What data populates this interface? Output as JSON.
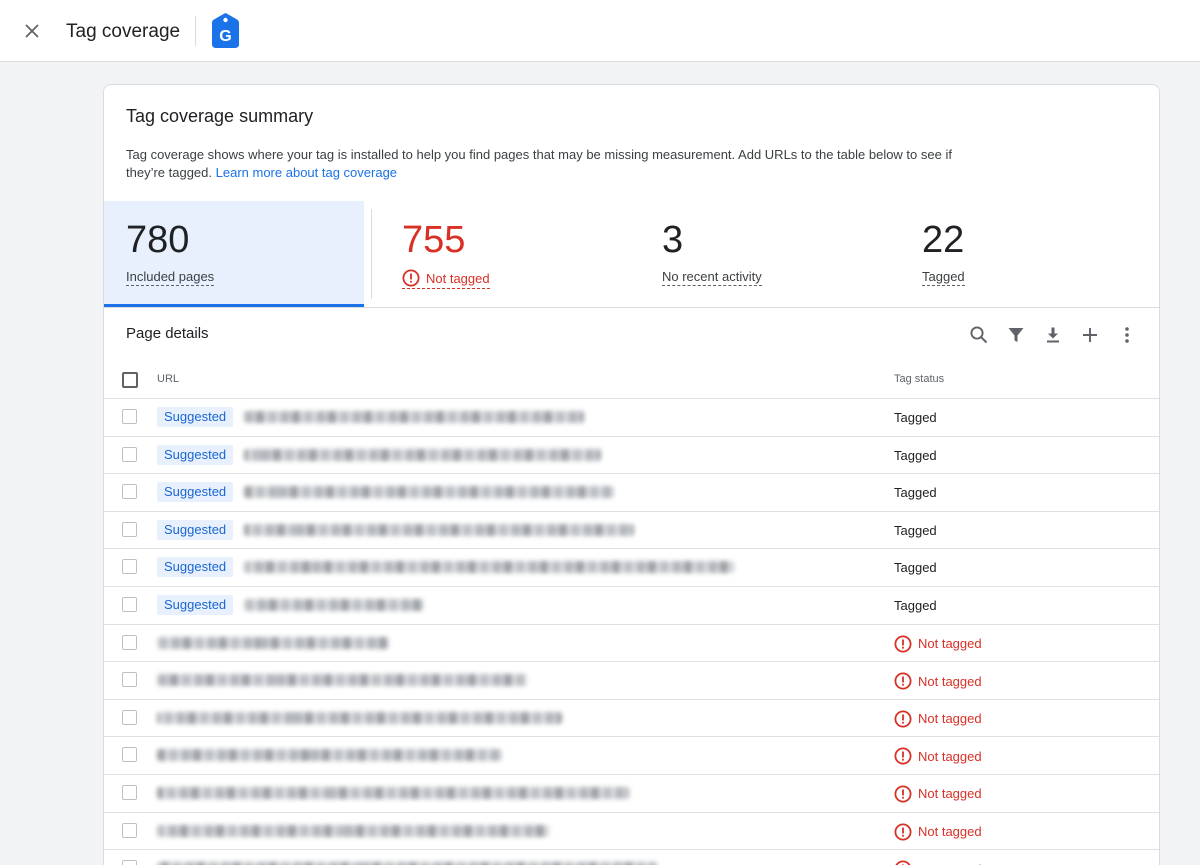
{
  "app": {
    "title": "Tag coverage",
    "logo_letter": "G",
    "colors": {
      "accent": "#1a73e8",
      "danger": "#d93025",
      "selected_bg": "#e8f0fe"
    }
  },
  "summary": {
    "title": "Tag coverage summary",
    "description": "Tag coverage shows where your tag is installed to help you find pages that may be missing measurement. Add URLs to the table below to see if they’re tagged.",
    "learn_more": "Learn more about tag coverage",
    "metrics": [
      {
        "value": "780",
        "label": "Included pages",
        "selected": true
      },
      {
        "value": "755",
        "label": "Not tagged",
        "icon": "error-icon"
      },
      {
        "value": "3",
        "label": "No recent activity"
      },
      {
        "value": "22",
        "label": "Tagged"
      }
    ]
  },
  "details": {
    "title": "Page details",
    "toolbar": [
      "search-icon",
      "filter-icon",
      "download-icon",
      "add-icon",
      "more-vert-icon"
    ],
    "columns": {
      "url": "URL",
      "status": "Tag status"
    },
    "suggested_label": "Suggested",
    "rows": [
      {
        "suggested": true,
        "url_blurred": true,
        "status": "Tagged"
      },
      {
        "suggested": true,
        "url_blurred": true,
        "status": "Tagged"
      },
      {
        "suggested": true,
        "url_blurred": true,
        "status": "Tagged"
      },
      {
        "suggested": true,
        "url_blurred": true,
        "status": "Tagged"
      },
      {
        "suggested": true,
        "url_blurred": true,
        "status": "Tagged"
      },
      {
        "suggested": true,
        "url_blurred": true,
        "status": "Tagged"
      },
      {
        "suggested": false,
        "url_blurred": true,
        "status": "Not tagged"
      },
      {
        "suggested": false,
        "url_blurred": true,
        "status": "Not tagged"
      },
      {
        "suggested": false,
        "url_blurred": true,
        "status": "Not tagged"
      },
      {
        "suggested": false,
        "url_blurred": true,
        "status": "Not tagged"
      },
      {
        "suggested": false,
        "url_blurred": true,
        "status": "Not tagged"
      },
      {
        "suggested": false,
        "url_blurred": true,
        "status": "Not tagged"
      },
      {
        "suggested": false,
        "url_blurred": true,
        "status": "Not tagged"
      }
    ]
  }
}
